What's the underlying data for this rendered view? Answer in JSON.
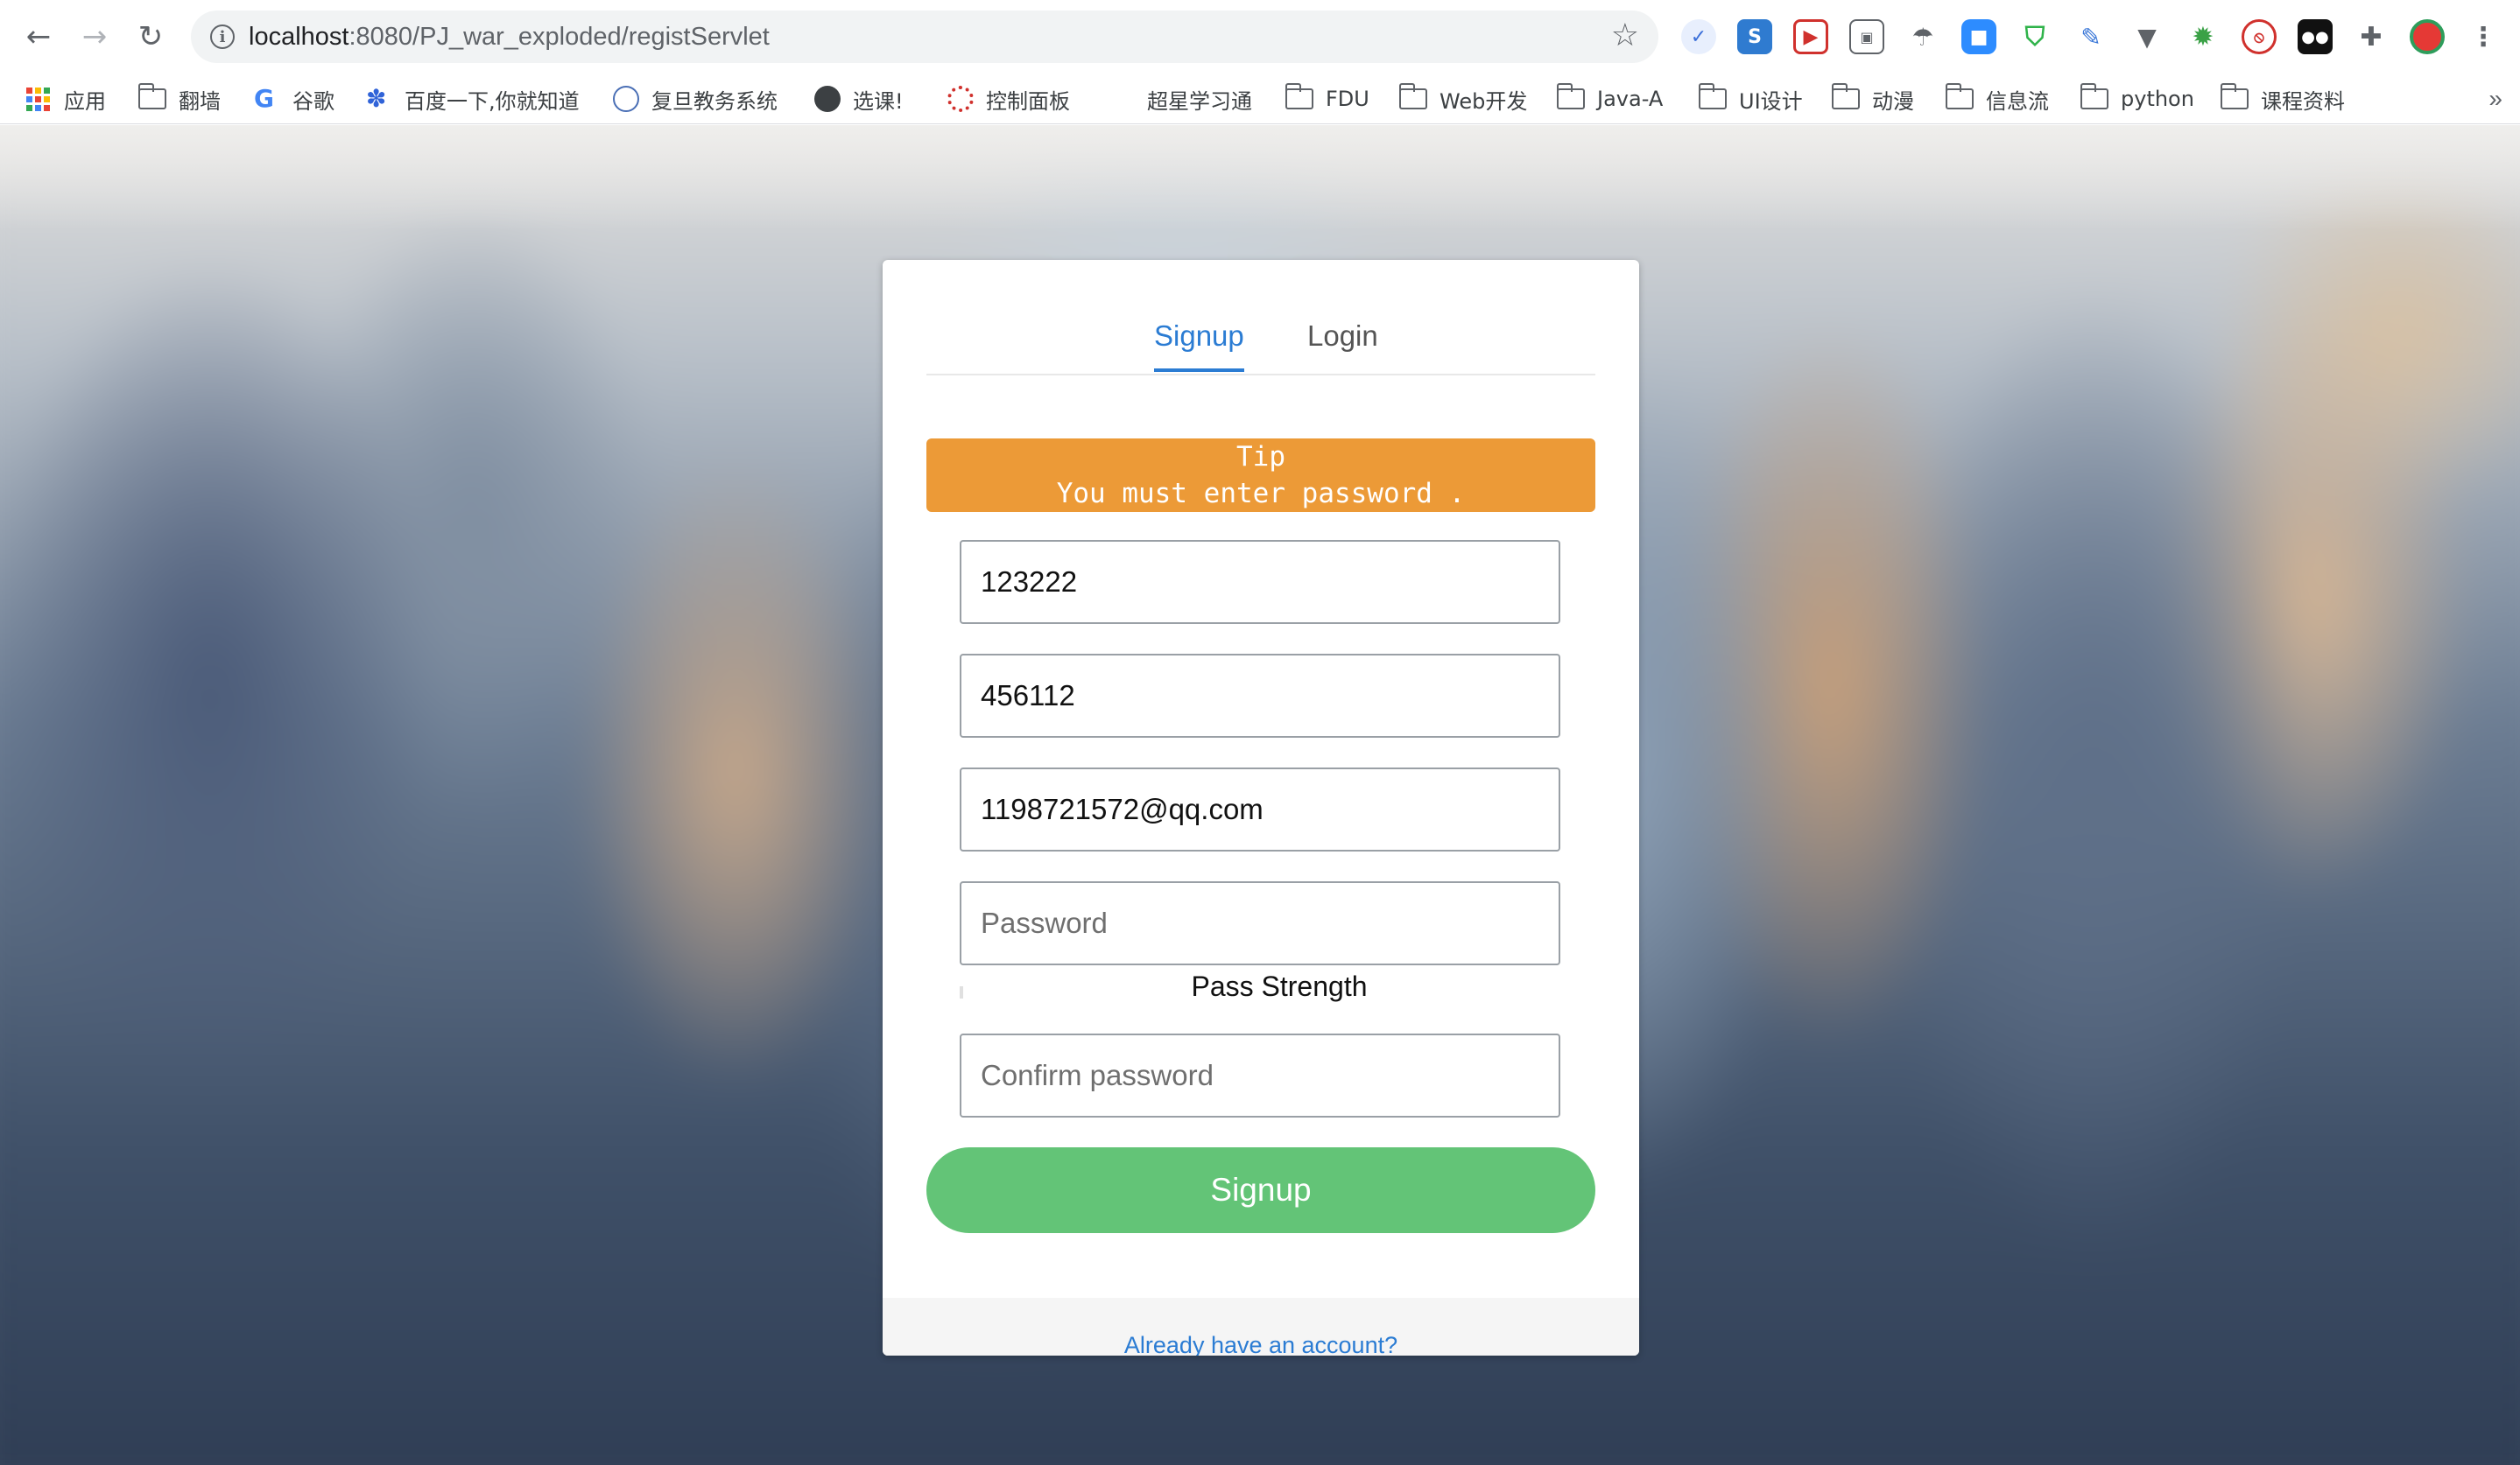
{
  "browser": {
    "url_host": "localhost",
    "url_path": ":8080/PJ_war_exploded/registServlet",
    "bookmarks": [
      "应用",
      "翻墙",
      "谷歌",
      "百度一下,你就知道",
      "复旦教务系统",
      "选课!",
      "控制面板",
      "超星学习通",
      "FDU",
      "Web开发",
      "Java-A",
      "UI设计",
      "动漫",
      "信息流",
      "python",
      "课程资料"
    ],
    "more_label": "»"
  },
  "form": {
    "tabs": [
      "Signup",
      "Login"
    ],
    "active_tab": "Signup",
    "tip_title": "Tip",
    "tip_message": "You must enter password .",
    "tip_color": "#ec9a37",
    "fields": [
      {
        "value": "123222",
        "placeholder": ""
      },
      {
        "value": "456112",
        "placeholder": ""
      },
      {
        "value": "1198721572@qq.com",
        "placeholder": ""
      },
      {
        "value": "",
        "placeholder": "Password"
      },
      {
        "value": "",
        "placeholder": "Confirm password"
      }
    ],
    "strength_label": "Pass Strength",
    "submit_label": "Signup",
    "submit_color": "#63c477",
    "footer_link": "Already have an account?",
    "accent_color": "#2b7cd3"
  }
}
